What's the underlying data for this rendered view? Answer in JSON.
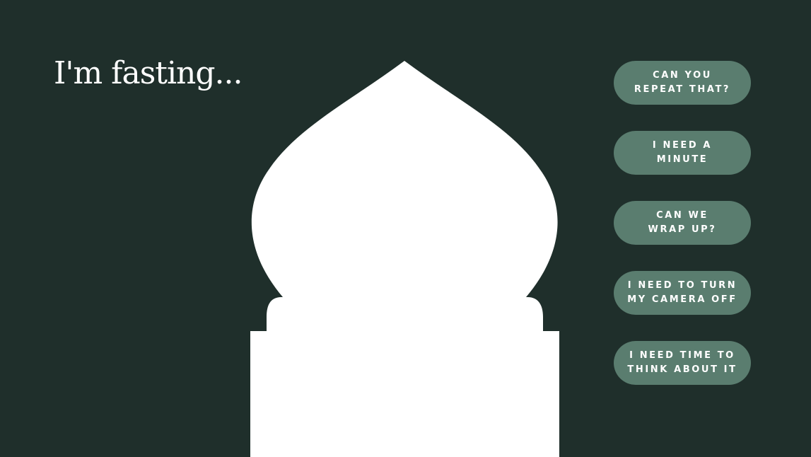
{
  "title": "I'm fasting...",
  "colors": {
    "background": "#1f2f2b",
    "arch": "#ffffff",
    "button": "#5a7d6f",
    "text": "#ffffff"
  },
  "buttons": [
    {
      "label": "CAN YOU\nREPEAT THAT?"
    },
    {
      "label": "I NEED A\nMINUTE"
    },
    {
      "label": "CAN WE\nWRAP UP?"
    },
    {
      "label": "I NEED TO TURN\nMY CAMERA OFF"
    },
    {
      "label": "I NEED TIME TO\nTHINK ABOUT IT"
    }
  ]
}
